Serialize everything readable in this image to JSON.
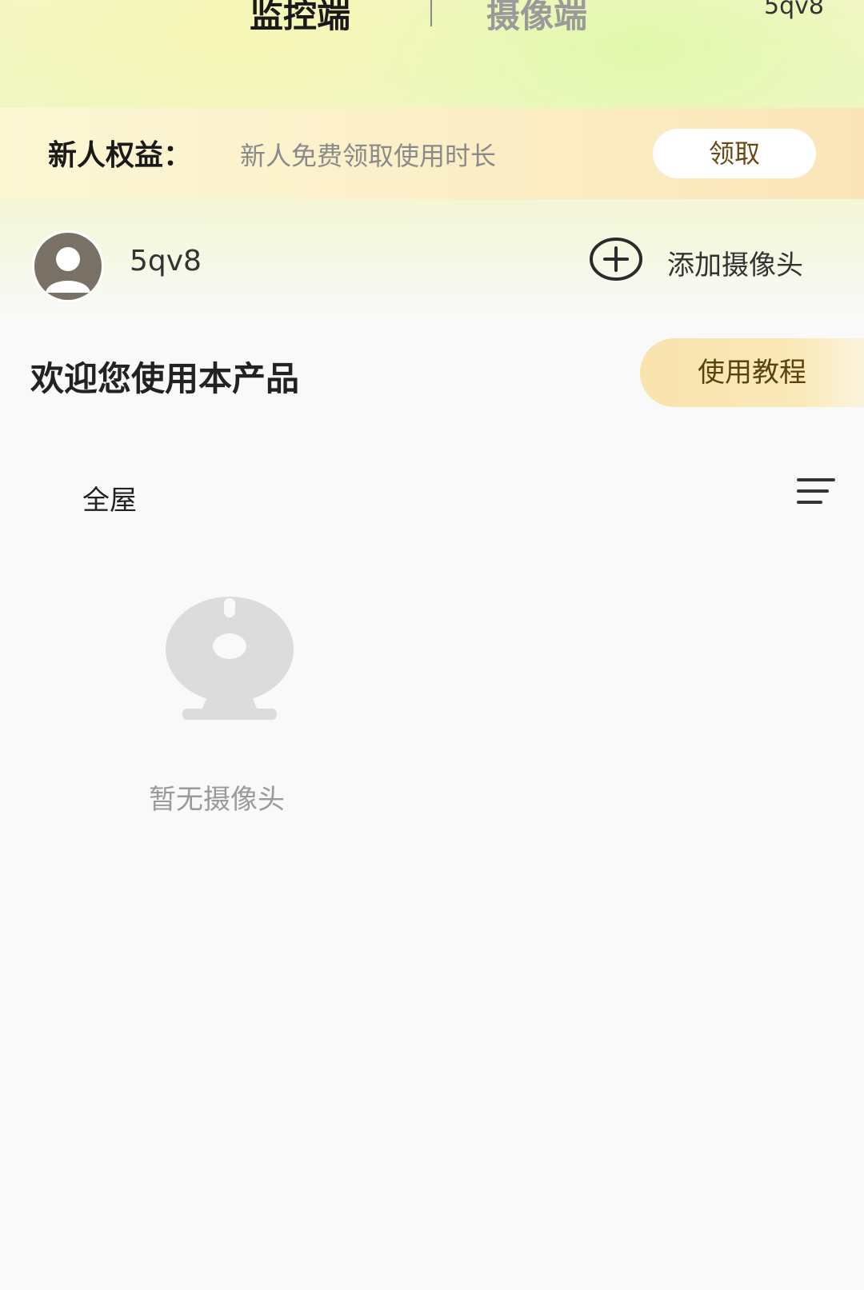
{
  "header": {
    "tabs": [
      {
        "label": "监控端",
        "active": true
      },
      {
        "label": "摄像端",
        "active": false
      }
    ],
    "user_label": "5qv8"
  },
  "benefits_banner": {
    "title": "新人权益：",
    "description": "新人免费领取使用时长",
    "button_label": "领取"
  },
  "user": {
    "name": "5qv8",
    "add_camera_label": "添加摄像头",
    "icons": {
      "avatar": "default-avatar-icon",
      "add": "plus-circle-icon"
    }
  },
  "welcome": {
    "text": "欢迎您使用本产品",
    "tutorial_label": "使用教程"
  },
  "rooms": {
    "selected": "全屋",
    "menu_icon": "menu-icon"
  },
  "empty_state": {
    "icon": "camera-icon",
    "message": "暂无摄像头"
  },
  "colors": {
    "accent_gold": "#f9e3ad",
    "primary_text": "#222222",
    "muted_text": "#9a9a9a"
  }
}
